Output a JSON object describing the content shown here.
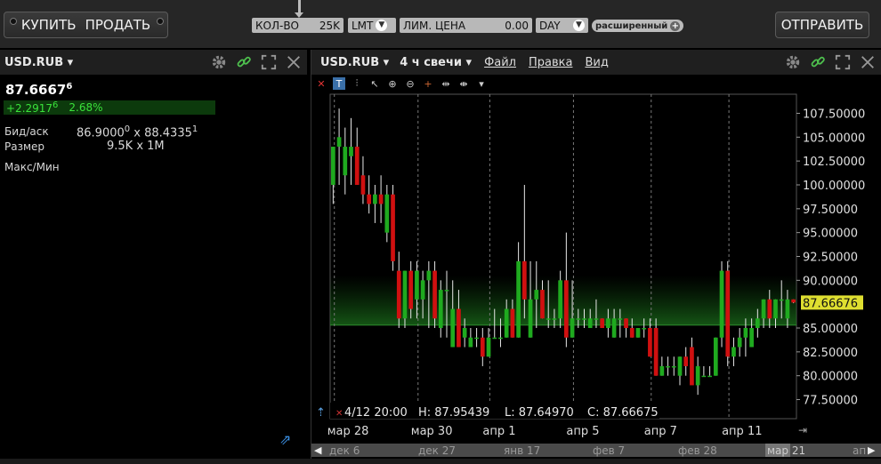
{
  "order_bar": {
    "buy_label": "КУПИТЬ",
    "sell_label": "ПРОДАТЬ",
    "qty_label": "КОЛ-ВО",
    "qty_value": "25K",
    "order_type": "LMT",
    "limit_price_label": "ЛИМ. ЦЕНА",
    "limit_price_value": "0.00",
    "tif": "DAY",
    "extended_label": "расширенный",
    "submit_label": "ОТПРАВИТЬ"
  },
  "quote_panel": {
    "symbol": "USD.RUB",
    "last_price": "87.6667",
    "last_price_sup": "6",
    "change": "+2.2917",
    "change_sup": "6",
    "change_pct": "2.68%",
    "bid_ask_label": "Бид/аск",
    "bid": "86.9000",
    "bid_sup": "0",
    "ask": "88.4335",
    "ask_sup": "1",
    "size_label": "Размер",
    "size_value": "9.5K x 1M",
    "maxmin_label": "Макс/Мин"
  },
  "chart_panel": {
    "symbol": "USD.RUB",
    "timeframe": "4 ч свечи",
    "menu": [
      "Файл",
      "Правка",
      "Вид"
    ],
    "info_line": {
      "date": "4/12 20:00",
      "high": "H: 87.95439",
      "low": "L: 87.64970",
      "close": "C: 87.66675"
    },
    "price_tag": "87.66676",
    "scroll_labels": [
      "дек 6",
      "дек 27",
      "янв 17",
      "фев 7",
      "фев 28",
      "мар 21",
      "ап"
    ]
  },
  "colors": {
    "up": "#1faa1f",
    "down": "#d01010",
    "price_tag_bg": "#dede30",
    "change_bg": "#0c3a0c"
  },
  "chart_data": {
    "type": "candlestick",
    "symbol": "USD.RUB",
    "ylim": [
      75.5,
      109.5
    ],
    "y_ticks": [
      "107.50000",
      "105.00000",
      "102.50000",
      "100.00000",
      "97.50000",
      "95.00000",
      "92.50000",
      "90.00000",
      "87.66676",
      "85.00000",
      "82.50000",
      "80.00000",
      "77.50000"
    ],
    "y_tick_values": [
      107.5,
      105,
      102.5,
      100,
      97.5,
      95,
      92.5,
      90,
      87.66676,
      85,
      82.5,
      80,
      77.5
    ],
    "x_labels": [
      "мар 28",
      "мар 30",
      "апр 1",
      "апр 5",
      "апр 7",
      "апр 11"
    ],
    "x_label_index": [
      1,
      15,
      27,
      41,
      54,
      67
    ],
    "reference_price": 85.3,
    "candles": [
      {
        "o": 100,
        "h": 104,
        "l": 98,
        "c": 104
      },
      {
        "o": 104,
        "h": 108,
        "l": 100,
        "c": 105
      },
      {
        "o": 101,
        "h": 106,
        "l": 99,
        "c": 104
      },
      {
        "o": 103,
        "h": 107,
        "l": 100,
        "c": 104
      },
      {
        "o": 104,
        "h": 106,
        "l": 100,
        "c": 100
      },
      {
        "o": 101,
        "h": 103,
        "l": 98,
        "c": 99
      },
      {
        "o": 99,
        "h": 101,
        "l": 97,
        "c": 98
      },
      {
        "o": 98,
        "h": 100,
        "l": 96,
        "c": 99
      },
      {
        "o": 99,
        "h": 101,
        "l": 96,
        "c": 98
      },
      {
        "o": 95,
        "h": 100,
        "l": 94,
        "c": 99
      },
      {
        "o": 99,
        "h": 100,
        "l": 91,
        "c": 92
      },
      {
        "o": 91,
        "h": 93,
        "l": 85,
        "c": 86
      },
      {
        "o": 86,
        "h": 91,
        "l": 85,
        "c": 91
      },
      {
        "o": 91,
        "h": 92,
        "l": 86,
        "c": 87
      },
      {
        "o": 88,
        "h": 92,
        "l": 86,
        "c": 91
      },
      {
        "o": 88,
        "h": 91,
        "l": 86,
        "c": 90
      },
      {
        "o": 90,
        "h": 92,
        "l": 85,
        "c": 91
      },
      {
        "o": 91,
        "h": 92,
        "l": 85,
        "c": 86
      },
      {
        "o": 85,
        "h": 90,
        "l": 84,
        "c": 89
      },
      {
        "o": 89,
        "h": 91,
        "l": 84,
        "c": 89
      },
      {
        "o": 83,
        "h": 90,
        "l": 83,
        "c": 87
      },
      {
        "o": 87,
        "h": 89,
        "l": 83,
        "c": 83
      },
      {
        "o": 84,
        "h": 86,
        "l": 83,
        "c": 85
      },
      {
        "o": 83,
        "h": 85,
        "l": 83,
        "c": 84
      },
      {
        "o": 84,
        "h": 85,
        "l": 83,
        "c": 84
      },
      {
        "o": 84,
        "h": 85,
        "l": 81,
        "c": 82
      },
      {
        "o": 82,
        "h": 85,
        "l": 82,
        "c": 84
      },
      {
        "o": 84,
        "h": 87,
        "l": 84,
        "c": 84
      },
      {
        "o": 84,
        "h": 86,
        "l": 83,
        "c": 84
      },
      {
        "o": 84,
        "h": 88,
        "l": 84,
        "c": 87
      },
      {
        "o": 87,
        "h": 88,
        "l": 84,
        "c": 84
      },
      {
        "o": 84,
        "h": 94,
        "l": 84,
        "c": 92
      },
      {
        "o": 92,
        "h": 100,
        "l": 86,
        "c": 88
      },
      {
        "o": 84,
        "h": 92,
        "l": 84,
        "c": 88
      },
      {
        "o": 88,
        "h": 92,
        "l": 85,
        "c": 89
      },
      {
        "o": 89,
        "h": 90,
        "l": 86,
        "c": 86
      },
      {
        "o": 86,
        "h": 90,
        "l": 85,
        "c": 86
      },
      {
        "o": 86,
        "h": 87,
        "l": 85,
        "c": 86
      },
      {
        "o": 86,
        "h": 91,
        "l": 85,
        "c": 90
      },
      {
        "o": 90,
        "h": 95,
        "l": 83,
        "c": 84
      },
      {
        "o": 84,
        "h": 90,
        "l": 84,
        "c": 86
      },
      {
        "o": 86,
        "h": 87,
        "l": 85,
        "c": 86
      },
      {
        "o": 86,
        "h": 87,
        "l": 85,
        "c": 86
      },
      {
        "o": 85,
        "h": 87,
        "l": 85,
        "c": 86
      },
      {
        "o": 86,
        "h": 88,
        "l": 85,
        "c": 86
      },
      {
        "o": 86,
        "h": 86,
        "l": 85,
        "c": 85
      },
      {
        "o": 85,
        "h": 87,
        "l": 84,
        "c": 86
      },
      {
        "o": 84,
        "h": 87,
        "l": 84,
        "c": 86
      },
      {
        "o": 86,
        "h": 87,
        "l": 84,
        "c": 86
      },
      {
        "o": 86,
        "h": 86,
        "l": 84,
        "c": 85
      },
      {
        "o": 85,
        "h": 86,
        "l": 84,
        "c": 84
      },
      {
        "o": 84,
        "h": 85,
        "l": 84,
        "c": 85
      },
      {
        "o": 85,
        "h": 86,
        "l": 84,
        "c": 85
      },
      {
        "o": 85,
        "h": 86,
        "l": 82,
        "c": 82
      },
      {
        "o": 85,
        "h": 86,
        "l": 80,
        "c": 80
      },
      {
        "o": 80,
        "h": 82,
        "l": 80,
        "c": 81
      },
      {
        "o": 81,
        "h": 82,
        "l": 80,
        "c": 81
      },
      {
        "o": 81,
        "h": 82,
        "l": 80,
        "c": 81
      },
      {
        "o": 80,
        "h": 82,
        "l": 79,
        "c": 82
      },
      {
        "o": 82,
        "h": 83,
        "l": 80,
        "c": 81
      },
      {
        "o": 83,
        "h": 84,
        "l": 80,
        "c": 79
      },
      {
        "o": 79,
        "h": 82,
        "l": 78,
        "c": 81
      },
      {
        "o": 80,
        "h": 81,
        "l": 80,
        "c": 80
      },
      {
        "o": 80,
        "h": 81,
        "l": 80,
        "c": 80
      },
      {
        "o": 80,
        "h": 84,
        "l": 80,
        "c": 84
      },
      {
        "o": 84,
        "h": 92,
        "l": 83,
        "c": 91
      },
      {
        "o": 91,
        "h": 92,
        "l": 81,
        "c": 82
      },
      {
        "o": 82,
        "h": 84,
        "l": 81,
        "c": 83
      },
      {
        "o": 83,
        "h": 85,
        "l": 82,
        "c": 84
      },
      {
        "o": 84,
        "h": 86,
        "l": 82,
        "c": 85
      },
      {
        "o": 83,
        "h": 86,
        "l": 83,
        "c": 85
      },
      {
        "o": 85,
        "h": 87,
        "l": 84,
        "c": 86
      },
      {
        "o": 86,
        "h": 88,
        "l": 85,
        "c": 88
      },
      {
        "o": 88,
        "h": 89,
        "l": 85,
        "c": 86
      },
      {
        "o": 86,
        "h": 88,
        "l": 85,
        "c": 88
      },
      {
        "o": 88,
        "h": 90,
        "l": 86,
        "c": 88
      },
      {
        "o": 86,
        "h": 89,
        "l": 85,
        "c": 88
      },
      {
        "o": 88,
        "h": 88,
        "l": 87.6,
        "c": 87.67
      }
    ]
  }
}
